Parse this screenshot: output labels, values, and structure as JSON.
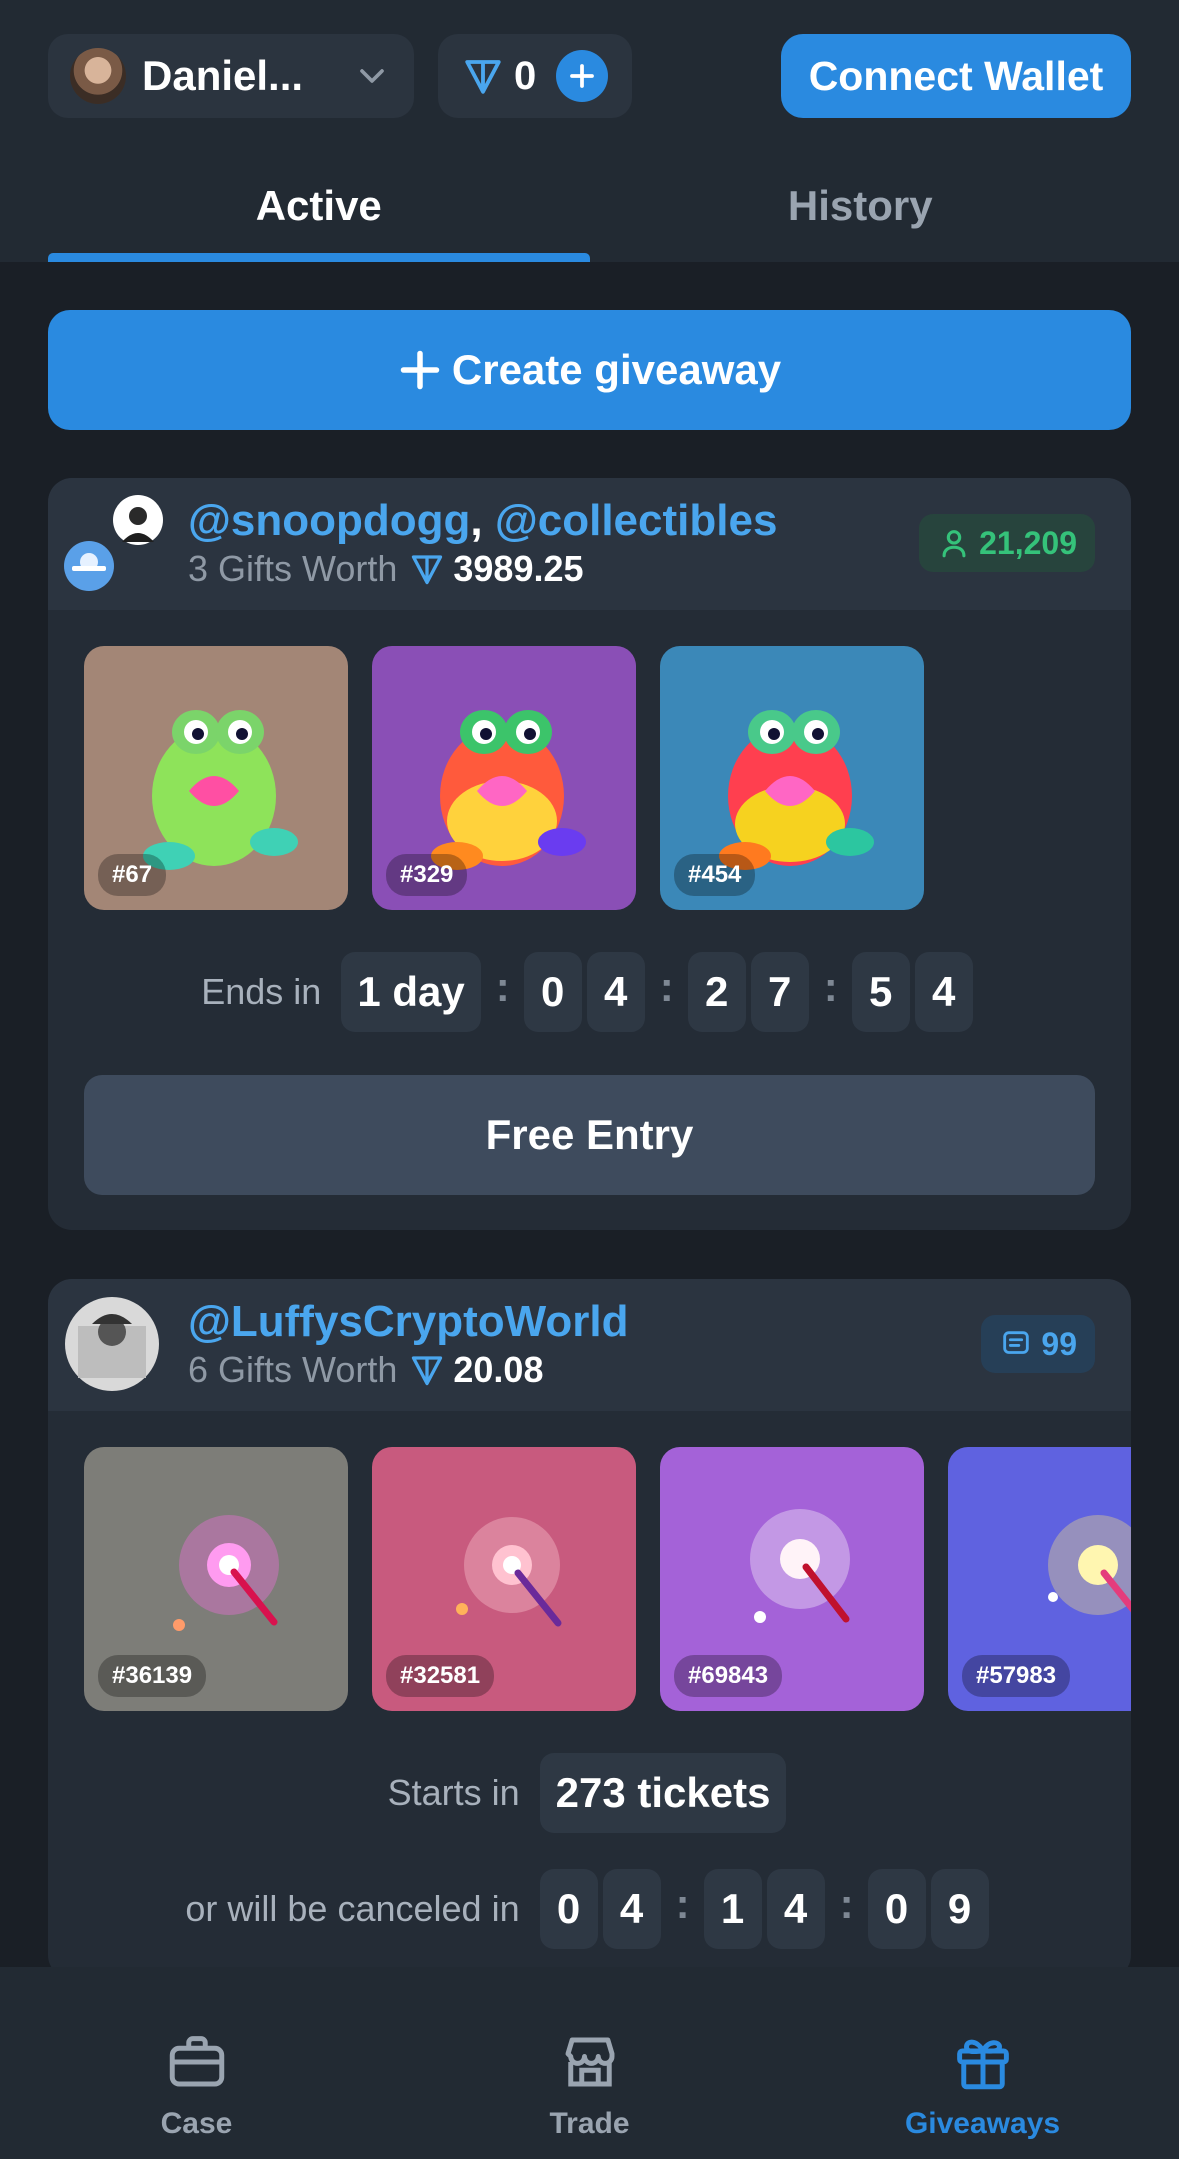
{
  "header": {
    "user_name": "Daniel...",
    "balance": "0",
    "connect_wallet": "Connect Wallet"
  },
  "tabs": [
    {
      "label": "Active",
      "active": true
    },
    {
      "label": "History",
      "active": false
    }
  ],
  "create_giveaway": "Create giveaway",
  "giveaways": [
    {
      "creator_1": "@snoopdogg",
      "separator": ",",
      "creator_2": "@collectibles",
      "gifts_label": "3 Gifts Worth",
      "worth": "3989.25",
      "participants": "21,209",
      "gifts": [
        {
          "number": "#67",
          "bg": "#a38676"
        },
        {
          "number": "#329",
          "bg": "#8a4fb6"
        },
        {
          "number": "#454",
          "bg": "#3b88b8"
        }
      ],
      "ends_label": "Ends in",
      "ends_days": "1 day",
      "ends_digits": [
        "0",
        "4",
        "2",
        "7",
        "5",
        "4"
      ],
      "entry_button": "Free Entry"
    },
    {
      "creator_1": "@LuffysCryptoWorld",
      "gifts_label": "6 Gifts Worth",
      "worth": "20.08",
      "tickets_count": "99",
      "gifts": [
        {
          "number": "#36139",
          "bg": "#7d7d78"
        },
        {
          "number": "#32581",
          "bg": "#c85a7e"
        },
        {
          "number": "#69843",
          "bg": "#a462d8"
        },
        {
          "number": "#57983",
          "bg": "#5f62e0"
        }
      ],
      "starts_label": "Starts in",
      "starts_value": "273 tickets",
      "cancel_label": "or will be canceled in",
      "cancel_digits": [
        "0",
        "4",
        "1",
        "4",
        "0",
        "9"
      ]
    }
  ],
  "nav": [
    {
      "label": "Case",
      "icon": "briefcase-icon",
      "active": false
    },
    {
      "label": "Trade",
      "icon": "store-icon",
      "active": false
    },
    {
      "label": "Giveaways",
      "icon": "gift-icon",
      "active": true
    }
  ],
  "colors": {
    "accent": "#2a8ae0",
    "link": "#4aa6ee",
    "green": "#35c27a",
    "bg": "#1a1f26"
  }
}
